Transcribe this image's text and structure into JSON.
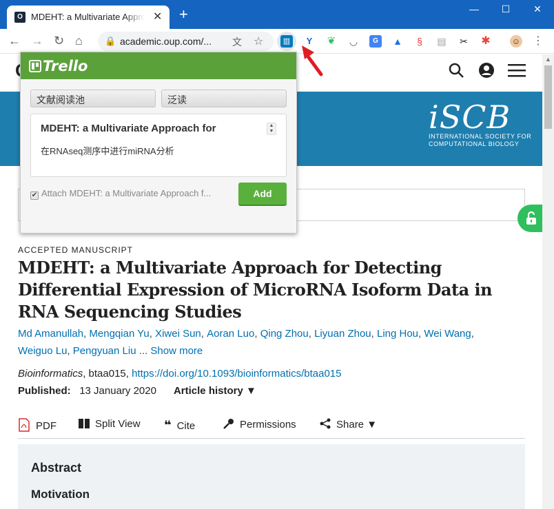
{
  "browser": {
    "tab_title": "MDEHT: a Multivariate Approach for Detecting Differential Expression",
    "tab_favicon": "O",
    "url": "academic.oup.com/...",
    "new_tab_label": "+",
    "window_controls": {
      "minimize": "—",
      "maximize": "☐",
      "close": "✕"
    }
  },
  "site_header": {
    "logo_letter": "O"
  },
  "banner": {
    "logo_word": "iSCB",
    "logo_subtitle_1": "INTERNATIONAL SOCIETY FOR",
    "logo_subtitle_2": "COMPUTATIONAL BIOLOGY",
    "accent_color": "#1e7eae"
  },
  "article": {
    "type_label": "ACCEPTED MANUSCRIPT",
    "title": "MDEHT: a Multivariate Approach for Detecting Differential Expression of MicroRNA Isoform Data in RNA Sequencing Studies",
    "authors": [
      "Md Amanullah",
      "Mengqian Yu",
      "Xiwei Sun",
      "Aoran Luo",
      "Qing Zhou",
      "Liyuan Zhou",
      "Ling Hou",
      "Wei Wang",
      "Weiguo Lu",
      "Pengyuan Liu"
    ],
    "authors_ellipsis": "...",
    "show_more": "Show more",
    "journal": "Bioinformatics",
    "article_id": ", btaa015, ",
    "doi": "https://doi.org/10.1093/bioinformatics/btaa015",
    "published_label": "Published:",
    "published_date": "13 January 2020",
    "history_label": "Article history ▼"
  },
  "tools": {
    "pdf": "PDF",
    "split_view": "Split View",
    "cite": "Cite",
    "permissions": "Permissions",
    "share": "Share ▼"
  },
  "abstract": {
    "heading": "Abstract",
    "section": "Motivation"
  },
  "trello_popup": {
    "logo": "Trello",
    "board_select": "文献阅读池",
    "list_select": "泛读",
    "card_title": "MDEHT: a Multivariate Approach for",
    "card_description": "在RNAseq测序中进行miRNA分析",
    "attach_label": "Attach MDEHT: a Multivariate Approach f...",
    "attach_checked": true,
    "add_button": "Add",
    "header_color": "#5aa13a",
    "button_color": "#5ab03c"
  },
  "icons": {
    "back": "back-arrow-icon",
    "forward": "forward-arrow-icon",
    "reload": "reload-icon",
    "home": "home-icon",
    "lock": "lock-icon",
    "translate": "translate-icon",
    "star": "star-icon",
    "search": "search-icon",
    "account": "account-icon",
    "menu": "hamburger-menu-icon",
    "unlock": "unlock-icon"
  }
}
